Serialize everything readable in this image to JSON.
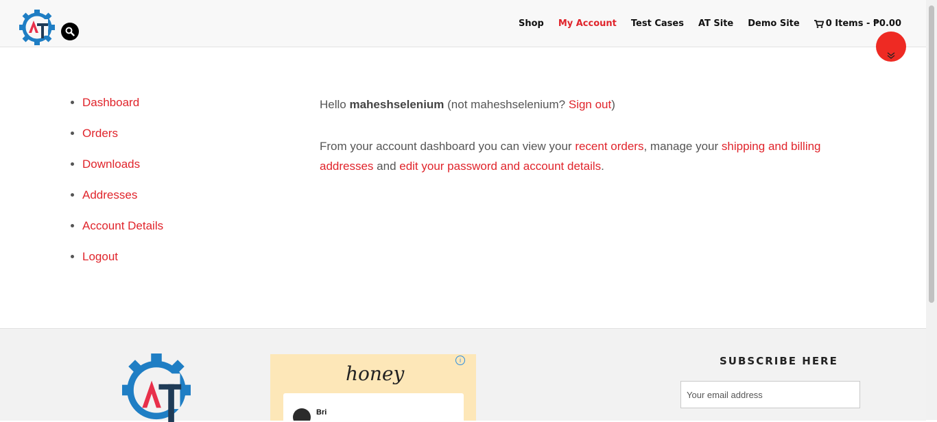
{
  "header": {
    "nav": [
      {
        "label": "Shop",
        "active": false
      },
      {
        "label": "My Account",
        "active": true
      },
      {
        "label": "Test Cases",
        "active": false
      },
      {
        "label": "AT Site",
        "active": false
      },
      {
        "label": "Demo Site",
        "active": false
      }
    ],
    "cart_label": "0 Items - ₱0.00"
  },
  "account_nav": [
    "Dashboard",
    "Orders",
    "Downloads",
    "Addresses",
    "Account Details",
    "Logout"
  ],
  "content": {
    "hello": "Hello ",
    "username": "maheshselenium",
    "not_prefix": " (not maheshselenium? ",
    "sign_out": "Sign out",
    "not_suffix": ")",
    "p2_a": "From your account dashboard you can view your ",
    "recent_orders": "recent orders",
    "p2_b": ", manage your ",
    "addresses_link": "shipping and billing addresses",
    "p2_c": " and ",
    "account_link": "edit your password and account details",
    "p2_d": "."
  },
  "footer": {
    "ad_brand": "honey",
    "ad_user": "Bri",
    "subscribe_title": "SUBSCRIBE HERE",
    "email_placeholder": "Your email address"
  },
  "colors": {
    "accent": "#e0242b",
    "logo_blue": "#1f7ec4",
    "logo_dark": "#1f3b57"
  }
}
